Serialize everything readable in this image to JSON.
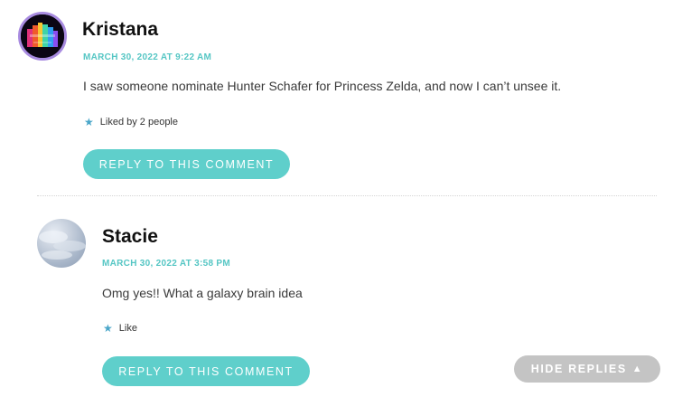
{
  "comments": [
    {
      "author": "Kristana",
      "date": "MARCH 30, 2022 AT 9:22 AM",
      "text": "I saw someone nominate Hunter Schafer for Princess Zelda, and now I can’t unsee it.",
      "like_text": "Liked by 2 people",
      "reply_label": "REPLY TO THIS COMMENT",
      "avatar_icon": "colorful-castle-avatar"
    },
    {
      "author": "Stacie",
      "date": "MARCH 30, 2022 AT 3:58 PM",
      "text": "Omg yes!! What a galaxy brain idea",
      "like_text": "Like",
      "reply_label": "REPLY TO THIS COMMENT",
      "avatar_icon": "cloudy-sky-avatar"
    }
  ],
  "hide_replies_label": "HIDE REPLIES",
  "like_icon": "star-icon",
  "colors": {
    "accent": "#5fcfcb",
    "date": "#55c6c4",
    "star": "#4aa6c9",
    "hide_button": "#c4c4c4",
    "avatar_ring": "#a88be0"
  }
}
